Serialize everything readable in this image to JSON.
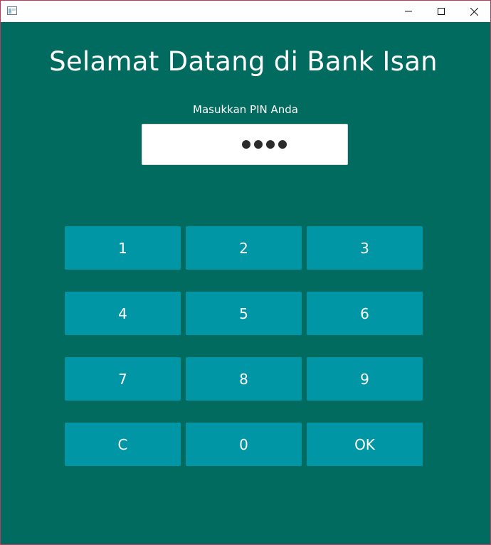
{
  "colors": {
    "background": "#006b5e",
    "key": "#0096a6",
    "text": "#ffffff",
    "input_bg": "#ffffff"
  },
  "titlebar": {
    "icons": [
      "app-icon",
      "minimize-icon",
      "maximize-icon",
      "close-icon"
    ]
  },
  "main": {
    "heading": "Selamat Datang di Bank Isan",
    "pin_label": "Masukkan PIN Anda",
    "pin_masked_length": 4
  },
  "keypad": {
    "keys": [
      "1",
      "2",
      "3",
      "4",
      "5",
      "6",
      "7",
      "8",
      "9",
      "C",
      "0",
      "OK"
    ]
  }
}
